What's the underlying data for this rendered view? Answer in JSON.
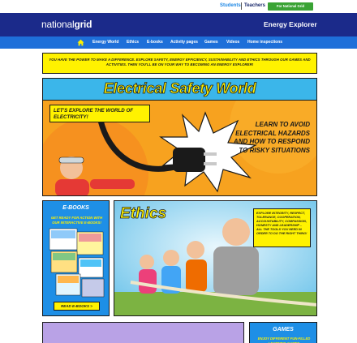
{
  "topbar": {
    "students_link": "Students",
    "teachers_link": "Teachers",
    "employees_button": "For National Grid employees"
  },
  "header": {
    "logo_light": "national",
    "logo_bold": "grid",
    "site_title": "Energy Explorer"
  },
  "nav": {
    "home_icon": "house-icon",
    "items": [
      "Energy World",
      "Ethics",
      "E-books",
      "Activity pages",
      "Games",
      "Videos",
      "Home inspections"
    ]
  },
  "intro": {
    "text": "YOU HAVE THE POWER TO MAKE A DIFFERENCE. EXPLORE SAFETY, ENERGY EFFICIENCY, SUSTAINABILITY AND ETHICS THROUGH OUR GAMES AND ACTIVITIES. THEN YOU'LL BE ON YOUR WAY TO BECOMING AN ENERGY EXPLORER!"
  },
  "electrical_safety": {
    "title": "Electrical Safety World",
    "bubble": "LET'S EXPLORE THE WORLD OF ELECTRICITY!",
    "learn": "LEARN TO AVOID ELECTRICAL HAZARDS AND HOW TO RESPOND TO RISKY SITUATIONS"
  },
  "ebooks": {
    "title": "E-BOOKS",
    "subtitle": "GET READY FOR ACTION WITH OUR INTERACTIVE E-BOOKS!",
    "button": "READ E-BOOKS >"
  },
  "ethics": {
    "title": "Ethics",
    "text": "EXPLORE INTEGRITY, RESPECT, TOLERANCE, COOPERATION, ACCOUNTABILITY, COMPASSION, HONESTY AND LEADERSHIP – ALL THE TOOLS YOU NEED IN ORDER TO DO THE RIGHT THING!"
  },
  "games": {
    "title": "GAMES",
    "subtitle": "ENJOY DIFFERENT FUN-FILLED LEARNING GAMES"
  },
  "colors": {
    "header_blue": "#1b2a8a",
    "nav_blue": "#1e6fd9",
    "accent_yellow": "#fff200",
    "employee_green": "#3aa335",
    "card_blue": "#1e8fe6"
  }
}
